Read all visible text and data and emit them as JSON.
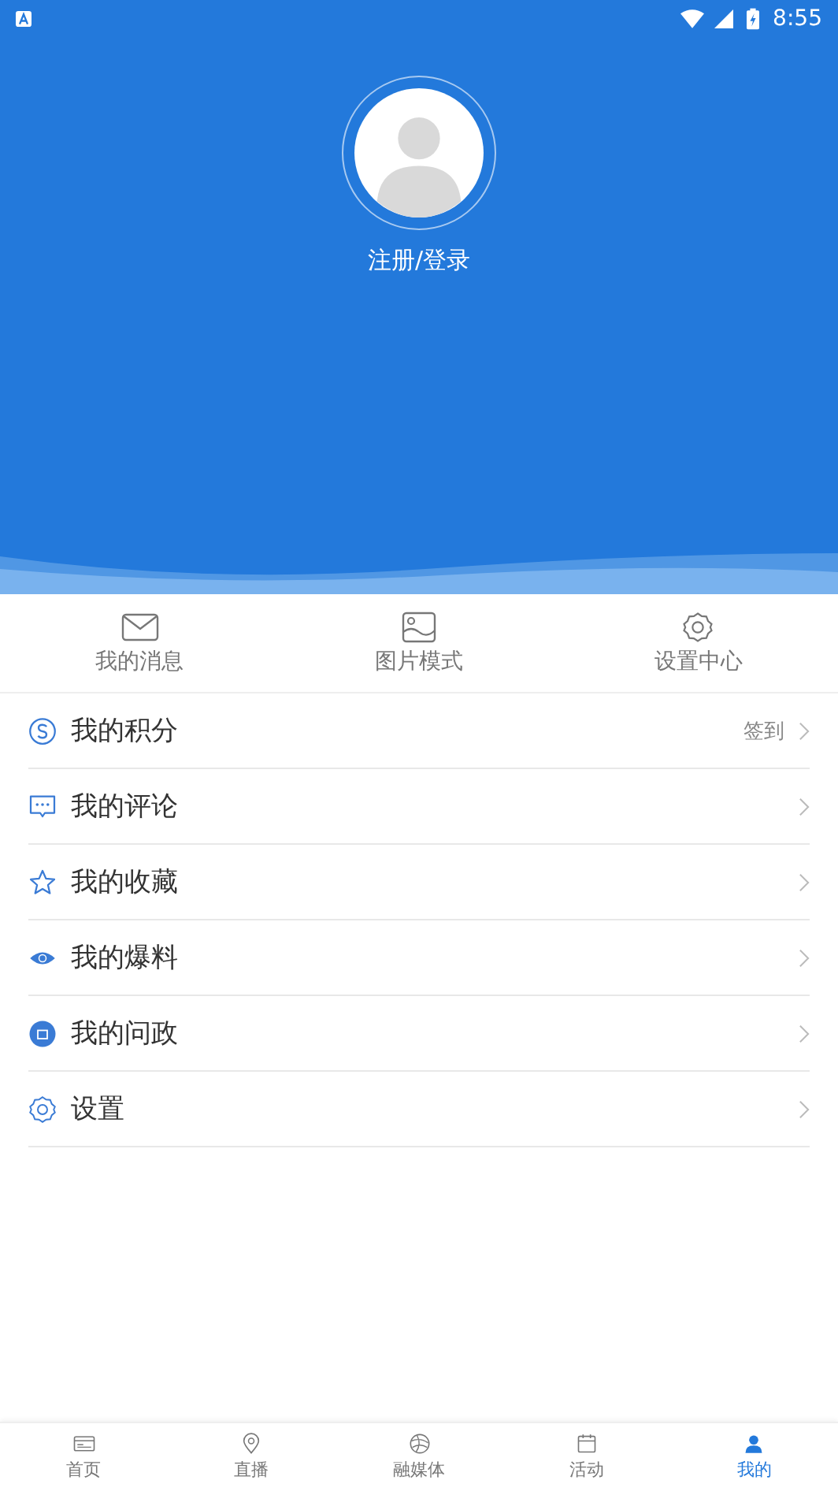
{
  "status_bar": {
    "time": "8:55"
  },
  "profile": {
    "login_label": "注册/登录"
  },
  "quick_actions": [
    {
      "label": "我的消息",
      "kind": "mail"
    },
    {
      "label": "图片模式",
      "kind": "image"
    },
    {
      "label": "设置中心",
      "kind": "gear"
    }
  ],
  "menu": [
    {
      "label": "我的积分",
      "kind": "points",
      "extra": "签到"
    },
    {
      "label": "我的评论",
      "kind": "comment"
    },
    {
      "label": "我的收藏",
      "kind": "star"
    },
    {
      "label": "我的爆料",
      "kind": "eye"
    },
    {
      "label": "我的问政",
      "kind": "ask"
    },
    {
      "label": "设置",
      "kind": "gear"
    }
  ],
  "tab_bar": [
    {
      "label": "首页",
      "kind": "home",
      "selected": false
    },
    {
      "label": "直播",
      "kind": "pin",
      "selected": false
    },
    {
      "label": "融媒体",
      "kind": "globe",
      "selected": false
    },
    {
      "label": "活动",
      "kind": "calendar",
      "selected": false
    },
    {
      "label": "我的",
      "kind": "person",
      "selected": true
    }
  ]
}
